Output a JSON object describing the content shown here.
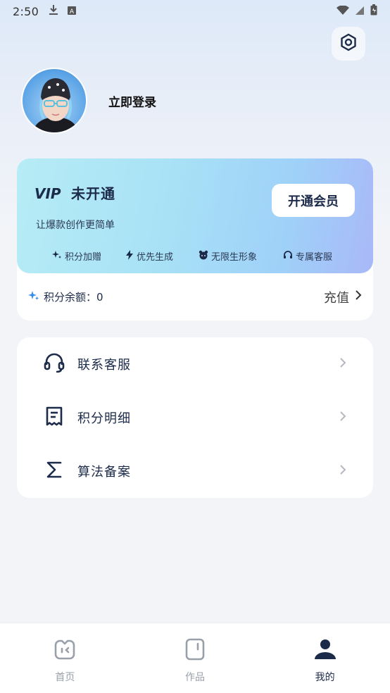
{
  "status_bar": {
    "time": "2:50"
  },
  "profile": {
    "login_text": "立即登录"
  },
  "vip": {
    "logo_text": "VIP",
    "status": "未开通",
    "subtitle": "让爆款创作更简单",
    "open_button": "开通会员",
    "perks": [
      {
        "label": "积分加赠",
        "icon": "sparkle-icon"
      },
      {
        "label": "优先生成",
        "icon": "lightning-icon"
      },
      {
        "label": "无限生形象",
        "icon": "bear-icon"
      },
      {
        "label": "专属客服",
        "icon": "headset-icon"
      }
    ],
    "balance_label": "积分余额：0",
    "recharge_label": "充值"
  },
  "menu": {
    "items": [
      {
        "label": "联系客服",
        "icon": "headset-icon"
      },
      {
        "label": "积分明细",
        "icon": "receipt-icon"
      },
      {
        "label": "算法备案",
        "icon": "sigma-icon"
      }
    ]
  },
  "tabs": [
    {
      "label": "首页",
      "icon": "home-icon",
      "active": false
    },
    {
      "label": "作品",
      "icon": "works-icon",
      "active": false
    },
    {
      "label": "我的",
      "icon": "profile-icon",
      "active": true
    }
  ],
  "colors": {
    "accent_dark": "#1c2b4a",
    "sparkle_blue": "#2f8cf0"
  }
}
